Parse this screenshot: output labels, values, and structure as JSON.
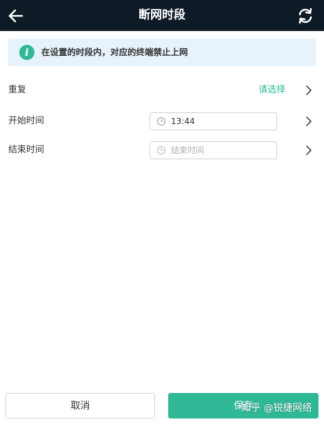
{
  "header": {
    "title": "断网时段",
    "background": "#0e1a26"
  },
  "notice": {
    "icon_letter": "i",
    "text": "在设置的时段内，对应的终端禁止上网",
    "background": "#e7f3fc"
  },
  "form": {
    "repeat": {
      "label": "重复",
      "value": "请选择"
    },
    "start_time": {
      "label": "开始时间",
      "value": "13:44"
    },
    "end_time": {
      "label": "结束时间",
      "placeholder": "结束时间"
    }
  },
  "footer": {
    "cancel_label": "取消",
    "save_label": "保存"
  },
  "watermark": {
    "text": "知乎 @锐捷网络"
  },
  "colors": {
    "accent": "#2fb895",
    "text": "#333333",
    "placeholder": "#b0b0b0"
  }
}
